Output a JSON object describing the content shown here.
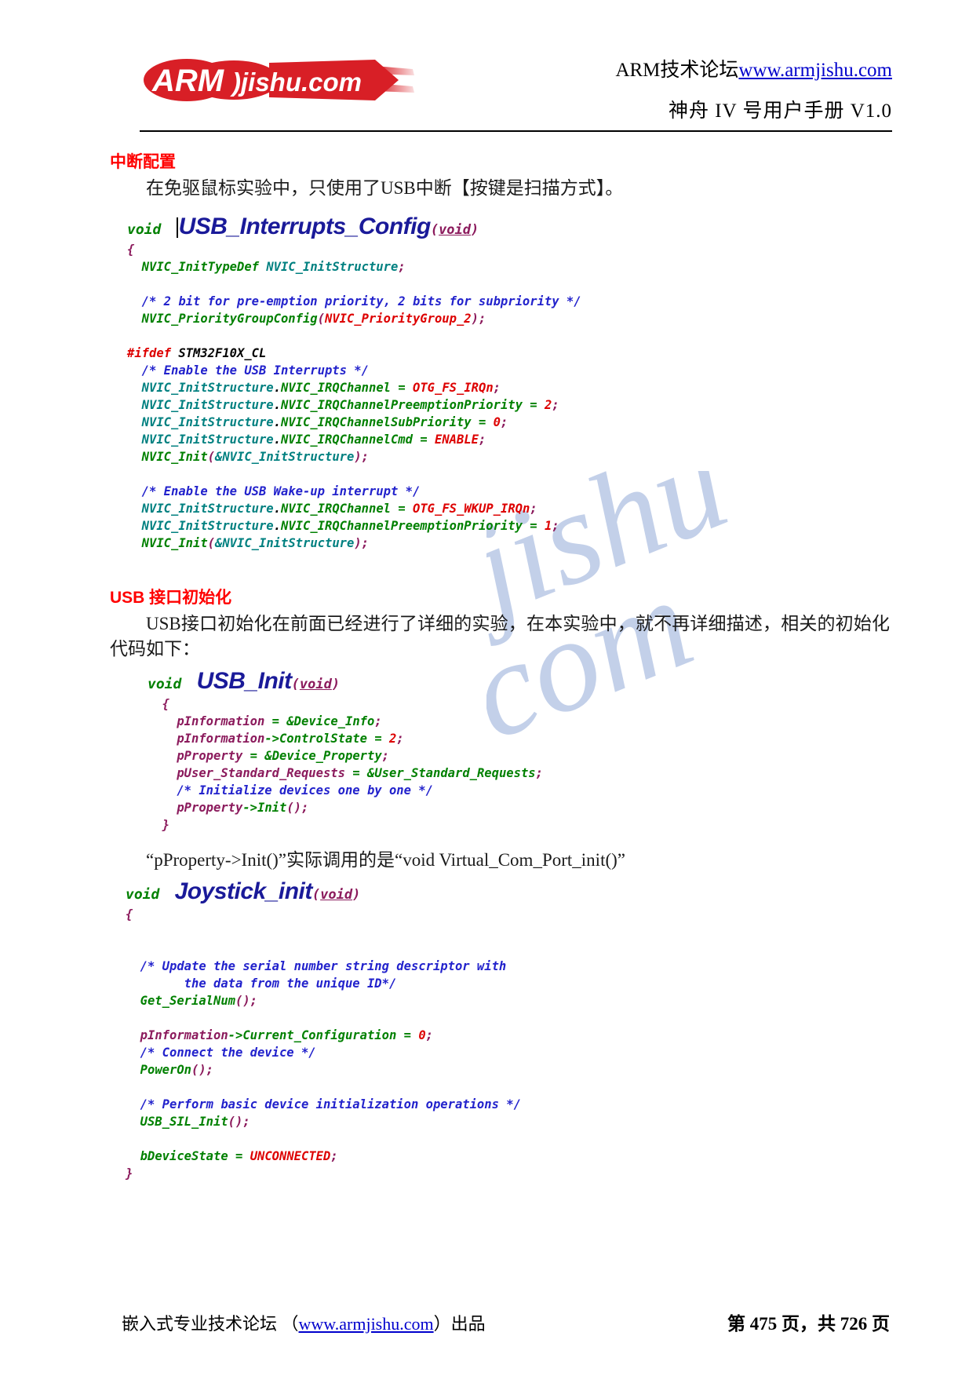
{
  "header": {
    "logo_main": "ARM",
    "logo_sub": "jishu.com",
    "title_cn": "ARM技术论坛",
    "title_url": "www.armjishu.com",
    "subtitle": "神舟 IV 号用户手册 V1.0"
  },
  "sections": [
    {
      "heading": "中断配置",
      "paragraph": "在免驱鼠标实验中，只使用了USB中断【按键是扫描方式】。"
    },
    {
      "heading": "USB 接口初始化",
      "paragraph": "USB接口初始化在前面已经进行了详细的实验，在本实验中，就不再详细描述，相关的初始化代码如下："
    }
  ],
  "code1": {
    "sig_kw": "void",
    "sig_name": "USB_Interrupts_Config",
    "sig_args": "(void)",
    "lines": [
      "{",
      "  NVIC_InitTypeDef NVIC_InitStructure;",
      "",
      "  /* 2 bit for pre-emption priority, 2 bits for subpriority */",
      "  NVIC_PriorityGroupConfig(NVIC_PriorityGroup_2);",
      "",
      "#ifdef STM32F10X_CL",
      "  /* Enable the USB Interrupts */",
      "  NVIC_InitStructure.NVIC_IRQChannel = OTG_FS_IRQn;",
      "  NVIC_InitStructure.NVIC_IRQChannelPreemptionPriority = 2;",
      "  NVIC_InitStructure.NVIC_IRQChannelSubPriority = 0;",
      "  NVIC_InitStructure.NVIC_IRQChannelCmd = ENABLE;",
      "  NVIC_Init(&NVIC_InitStructure);",
      "",
      "  /* Enable the USB Wake-up interrupt */",
      "  NVIC_InitStructure.NVIC_IRQChannel = OTG_FS_WKUP_IRQn;",
      "  NVIC_InitStructure.NVIC_IRQChannelPreemptionPriority = 1;",
      "  NVIC_Init(&NVIC_InitStructure);"
    ]
  },
  "code2": {
    "sig_kw": "void",
    "sig_name": "USB_Init",
    "sig_args": "(void)",
    "lines": [
      "{",
      "  pInformation = &Device_Info;",
      "  pInformation->ControlState = 2;",
      "  pProperty = &Device_Property;",
      "  pUser_Standard_Requests = &User_Standard_Requests;",
      "  /* Initialize devices one by one */",
      "  pProperty->Init();",
      "}"
    ]
  },
  "quote": "“pProperty->Init()”实际调用的是“void Virtual_Com_Port_init()”",
  "code3": {
    "sig_kw": "void",
    "sig_name": "Joystick_init",
    "sig_args": "(void)",
    "lines": [
      "{",
      "",
      "  /* Update the serial number string descriptor with",
      "        the data from the unique ID*/",
      "  Get_SerialNum();",
      "",
      "  pInformation->Current_Configuration = 0;",
      "  /* Connect the device */",
      "  PowerOn();",
      "",
      "  /* Perform basic device initialization operations */",
      "  USB_SIL_Init();",
      "",
      "  bDeviceState = UNCONNECTED;",
      "}"
    ]
  },
  "footer": {
    "left_pre": "嵌入式专业技术论坛 （",
    "left_url": "www.armjishu.com",
    "left_post": "）出品",
    "right": "第 475 页，共 726 页"
  },
  "colors": {
    "heading_red": "#ff0000",
    "code_green": "#008000",
    "code_teal": "#008080",
    "code_blue": "#2222cc",
    "code_red": "#dd0000",
    "code_purple": "#8b1a5c",
    "link_blue": "#0000cc",
    "logo_red": "#d81f26"
  }
}
